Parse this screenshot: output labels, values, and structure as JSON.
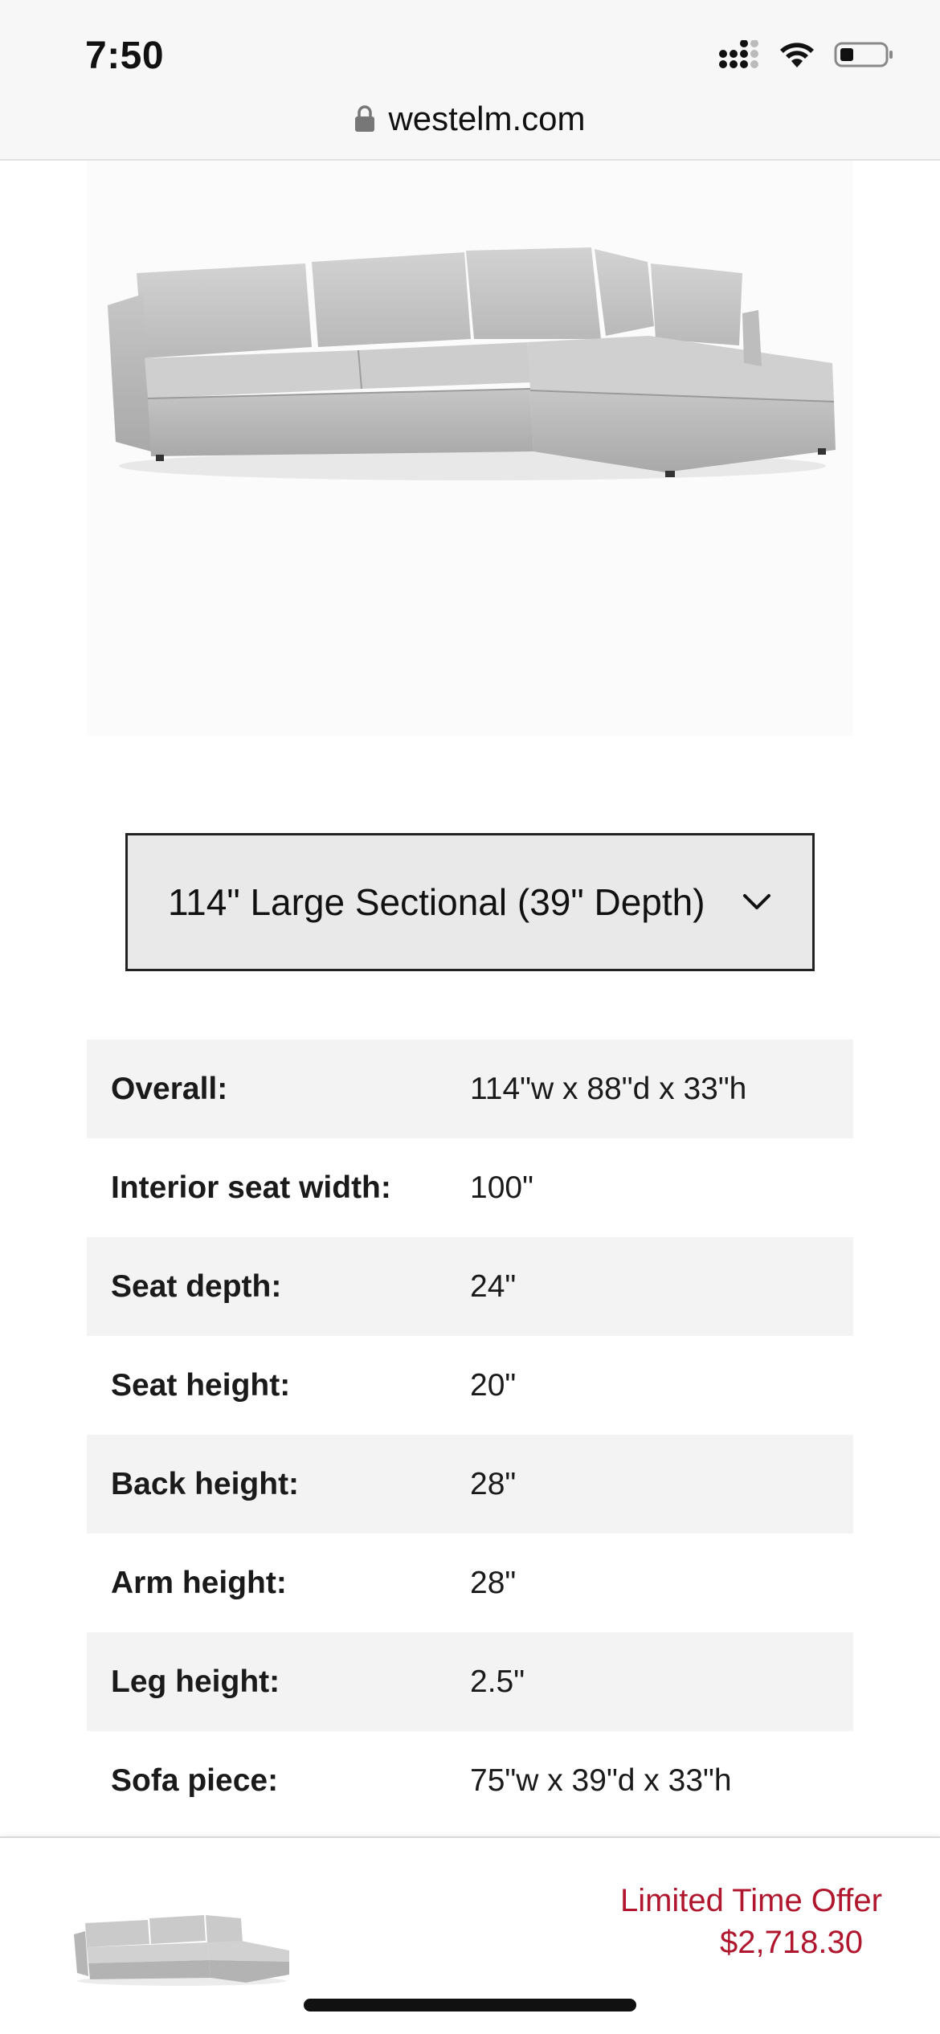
{
  "status_bar": {
    "time": "7:50"
  },
  "browser": {
    "url": "westelm.com"
  },
  "size_selector": {
    "selected": "114\" Large Sectional (39\" Depth)"
  },
  "specs": [
    {
      "label": "Overall:",
      "value": "114\"w x 88\"d x 33\"h"
    },
    {
      "label": "Interior seat width:",
      "value": "100\""
    },
    {
      "label": "Seat depth:",
      "value": "24\""
    },
    {
      "label": "Seat height:",
      "value": "20\""
    },
    {
      "label": "Back height:",
      "value": "28\""
    },
    {
      "label": "Arm height:",
      "value": "28\""
    },
    {
      "label": "Leg height:",
      "value": "2.5\""
    },
    {
      "label": "Sofa piece:",
      "value": "75\"w x 39\"d x 33\"h"
    }
  ],
  "offer": {
    "label": "Limited Time Offer",
    "price": "$2,718.30"
  },
  "colors": {
    "offer_red": "#b0172e",
    "row_shade": "#f3f3f3",
    "select_bg": "#e9e9e9"
  }
}
